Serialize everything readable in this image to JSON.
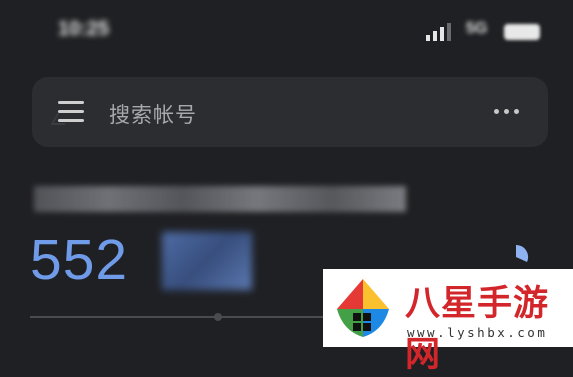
{
  "status_bar": {
    "time": "10:25",
    "network": "5G"
  },
  "search": {
    "placeholder": "搜索帐号"
  },
  "account": {
    "code": "552"
  },
  "watermark": {
    "title": "八星手游网",
    "url": "www.lyshbx.com"
  },
  "colors": {
    "background": "#1f2023",
    "search_bar": "#2c2d31",
    "code_accent": "#6f9be8",
    "watermark_red": "#d3262b"
  }
}
